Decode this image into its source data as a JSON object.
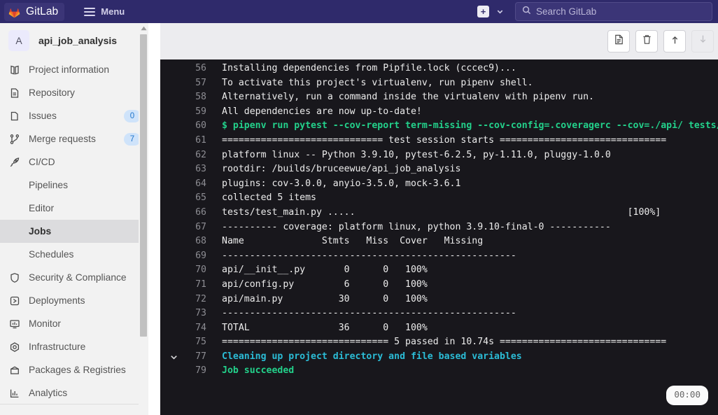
{
  "topnav": {
    "brand": "GitLab",
    "menu_label": "Menu",
    "new_icon_label": "+",
    "search_placeholder": "Search GitLab",
    "brand_bg": "#2f2a6b"
  },
  "sidebar": {
    "project": {
      "avatar_letter": "A",
      "name": "api_job_analysis"
    },
    "items": [
      {
        "label": "Project information",
        "icon": "project-information-icon",
        "badge": null,
        "sub": false,
        "active": false
      },
      {
        "label": "Repository",
        "icon": "repository-icon",
        "badge": null,
        "sub": false,
        "active": false
      },
      {
        "label": "Issues",
        "icon": "issues-icon",
        "badge": "0",
        "sub": false,
        "active": false
      },
      {
        "label": "Merge requests",
        "icon": "merge-requests-icon",
        "badge": "7",
        "sub": false,
        "active": false
      },
      {
        "label": "CI/CD",
        "icon": "rocket-icon",
        "badge": null,
        "sub": false,
        "active": false
      },
      {
        "label": "Pipelines",
        "icon": null,
        "badge": null,
        "sub": true,
        "active": false
      },
      {
        "label": "Editor",
        "icon": null,
        "badge": null,
        "sub": true,
        "active": false
      },
      {
        "label": "Jobs",
        "icon": null,
        "badge": null,
        "sub": true,
        "active": true
      },
      {
        "label": "Schedules",
        "icon": null,
        "badge": null,
        "sub": true,
        "active": false
      },
      {
        "label": "Security & Compliance",
        "icon": "shield-icon",
        "badge": null,
        "sub": false,
        "active": false
      },
      {
        "label": "Deployments",
        "icon": "deployments-icon",
        "badge": null,
        "sub": false,
        "active": false
      },
      {
        "label": "Monitor",
        "icon": "monitor-icon",
        "badge": null,
        "sub": false,
        "active": false
      },
      {
        "label": "Infrastructure",
        "icon": "infrastructure-icon",
        "badge": null,
        "sub": false,
        "active": false
      },
      {
        "label": "Packages & Registries",
        "icon": "package-icon",
        "badge": null,
        "sub": false,
        "active": false
      },
      {
        "label": "Analytics",
        "icon": "analytics-icon",
        "badge": null,
        "sub": false,
        "active": false
      }
    ],
    "badge_color": "#1f75cb",
    "active_bg": "#dcdcde"
  },
  "log_toolbar": {
    "buttons": [
      {
        "name": "show-complete-raw-button",
        "icon": "document-icon",
        "disabled": false
      },
      {
        "name": "erase-job-log-button",
        "icon": "trash-icon",
        "disabled": false
      },
      {
        "name": "scroll-to-top-button",
        "icon": "arrow-up-icon",
        "disabled": false
      },
      {
        "name": "scroll-to-bottom-button",
        "icon": "arrow-down-icon",
        "disabled": true
      }
    ]
  },
  "job_log": {
    "background": "#18171c",
    "timer": "00:00",
    "lines": [
      {
        "num": "56",
        "text": "Installing dependencies from Pipfile.lock (cccec9)...",
        "color": "plain",
        "toggle": false
      },
      {
        "num": "57",
        "text": "To activate this project's virtualenv, run pipenv shell.",
        "color": "plain",
        "toggle": false
      },
      {
        "num": "58",
        "text": "Alternatively, run a command inside the virtualenv with pipenv run.",
        "color": "plain",
        "toggle": false
      },
      {
        "num": "59",
        "text": "All dependencies are now up-to-date!",
        "color": "plain",
        "toggle": false
      },
      {
        "num": "60",
        "text": "$ pipenv run pytest --cov-report term-missing --cov-config=.coveragerc --cov=./api/ tests/",
        "color": "green",
        "toggle": false
      },
      {
        "num": "61",
        "text": "============================= test session starts ==============================",
        "color": "plain",
        "toggle": false
      },
      {
        "num": "62",
        "text": "platform linux -- Python 3.9.10, pytest-6.2.5, py-1.11.0, pluggy-1.0.0",
        "color": "plain",
        "toggle": false
      },
      {
        "num": "63",
        "text": "rootdir: /builds/bruceewue/api_job_analysis",
        "color": "plain",
        "toggle": false
      },
      {
        "num": "64",
        "text": "plugins: cov-3.0.0, anyio-3.5.0, mock-3.6.1",
        "color": "plain",
        "toggle": false
      },
      {
        "num": "65",
        "text": "collected 5 items",
        "color": "plain",
        "toggle": false
      },
      {
        "num": "66",
        "text": "tests/test_main.py .....                                                 [100%]",
        "color": "plain",
        "toggle": false
      },
      {
        "num": "67",
        "text": "---------- coverage: platform linux, python 3.9.10-final-0 -----------",
        "color": "plain",
        "toggle": false
      },
      {
        "num": "68",
        "text": "Name              Stmts   Miss  Cover   Missing",
        "color": "plain",
        "toggle": false
      },
      {
        "num": "69",
        "text": "-----------------------------------------------------",
        "color": "plain",
        "toggle": false
      },
      {
        "num": "70",
        "text": "api/__init__.py       0      0   100%",
        "color": "plain",
        "toggle": false
      },
      {
        "num": "71",
        "text": "api/config.py         6      0   100%",
        "color": "plain",
        "toggle": false
      },
      {
        "num": "72",
        "text": "api/main.py          30      0   100%",
        "color": "plain",
        "toggle": false
      },
      {
        "num": "73",
        "text": "-----------------------------------------------------",
        "color": "plain",
        "toggle": false
      },
      {
        "num": "74",
        "text": "TOTAL                36      0   100%",
        "color": "plain",
        "toggle": false
      },
      {
        "num": "75",
        "text": "============================== 5 passed in 10.74s ==============================",
        "color": "plain",
        "toggle": false
      },
      {
        "num": "77",
        "text": "Cleaning up project directory and file based variables",
        "color": "cyan",
        "toggle": true
      },
      {
        "num": "79",
        "text": "Job succeeded",
        "color": "green",
        "toggle": false
      }
    ]
  }
}
